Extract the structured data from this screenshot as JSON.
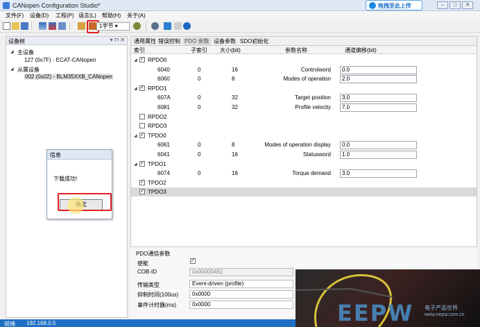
{
  "window": {
    "title": "CANopen Configuration Studio*",
    "upload_badge": "拖拽至此上传"
  },
  "menu": [
    "文件(F)",
    "设备(D)",
    "工程(P)",
    "语言(L)",
    "帮助(H)",
    "关于(A)"
  ],
  "toolbar": {
    "bytes_select": "1字节"
  },
  "left_pane": {
    "title": "设备树",
    "master_label": "主设备",
    "master_item": "127 (0x7F)  -  ECAT-CANopen",
    "slave_label": "从属设备",
    "slave_item": "002 (0x02)  -  BLM35XXB_CANopen"
  },
  "tabs": [
    "通用属性",
    "错误控制",
    "PDO 参数",
    "设备参数",
    "SDO初始化"
  ],
  "active_tab": "PDO 参数",
  "table": {
    "headers": [
      "索引",
      "子索引",
      "大小(bit)",
      "参数名称",
      "通道偏移(bit)"
    ],
    "rows": [
      {
        "type": "group",
        "checked": true,
        "name": "RPDO0"
      },
      {
        "type": "entry",
        "index": "6040",
        "sub": "0",
        "size": "16",
        "param": "Controlword",
        "offset": "0.0"
      },
      {
        "type": "entry",
        "index": "6060",
        "sub": "0",
        "size": "8",
        "param": "Modes of operation",
        "offset": "2.0"
      },
      {
        "type": "group",
        "checked": true,
        "name": "RPDO1"
      },
      {
        "type": "entry",
        "index": "607A",
        "sub": "0",
        "size": "32",
        "param": "Target position",
        "offset": "3.0"
      },
      {
        "type": "entry",
        "index": "6081",
        "sub": "0",
        "size": "32",
        "param": "Profile velocity",
        "offset": "7.0"
      },
      {
        "type": "group",
        "checked": false,
        "name": "RPDO2"
      },
      {
        "type": "group",
        "checked": false,
        "name": "RPDO3"
      },
      {
        "type": "group",
        "checked": true,
        "name": "TPDO0"
      },
      {
        "type": "entry",
        "index": "6061",
        "sub": "0",
        "size": "8",
        "param": "Modes of operation display",
        "offset": "0.0"
      },
      {
        "type": "entry",
        "index": "6041",
        "sub": "0",
        "size": "16",
        "param": "Statusword",
        "offset": "1.0"
      },
      {
        "type": "group",
        "checked": true,
        "name": "TPDO1"
      },
      {
        "type": "entry",
        "index": "6074",
        "sub": "0",
        "size": "16",
        "param": "Torque demand",
        "offset": "3.0"
      },
      {
        "type": "group",
        "checked": true,
        "name": "TPDO2"
      },
      {
        "type": "group",
        "checked": true,
        "name": "TPDO3",
        "selected": true
      }
    ]
  },
  "pdo_params": {
    "title": "PDO通信参数",
    "enable_label": "使能",
    "enable_checked": true,
    "cobid_label": "COB-ID",
    "cobid_value": "0x00000482",
    "trans_label": "传输类型",
    "trans_value": "Event-driven (profile)",
    "inhibit_label": "抑制时间(100us)",
    "inhibit_value": "0x0000",
    "event_label": "事件计时器(ms)",
    "event_value": "0x0000"
  },
  "dialog": {
    "title": "信息",
    "message": "下载成功!",
    "ok_label": "确定"
  },
  "status": {
    "state": "就绪",
    "ip": "192.168.0.5"
  },
  "watermark": {
    "logo": "EEPW",
    "sub": "电子产品世界",
    "url": "www.eepw.com.cn"
  },
  "colors": {
    "accent": "#1f6fc5",
    "highlight": "#e02020"
  }
}
